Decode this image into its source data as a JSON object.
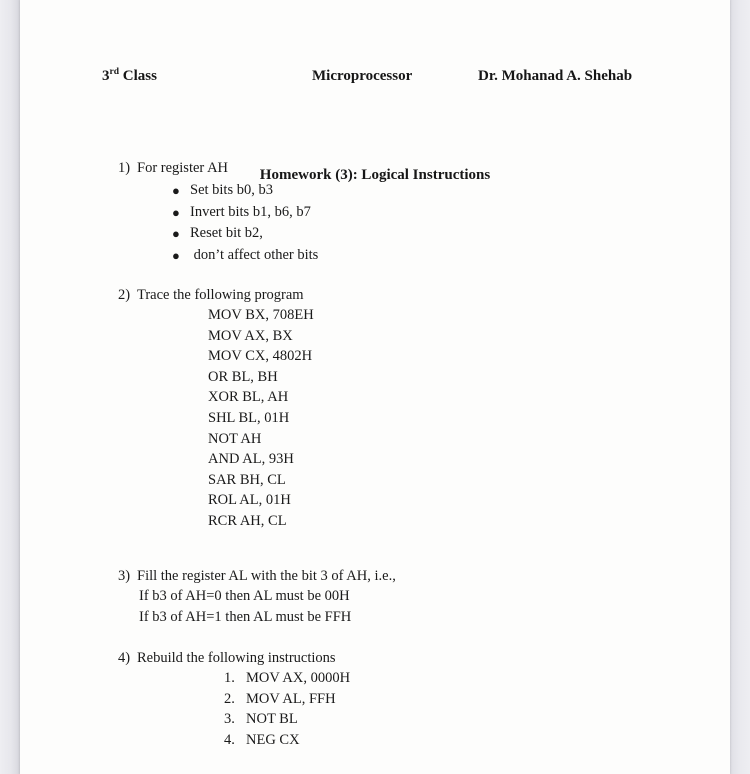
{
  "header": {
    "class_prefix": "3",
    "class_sup": "rd",
    "class_suffix": " Class",
    "subject": "Microprocessor",
    "lecturer": "Dr. Mohanad A. Shehab",
    "subtitle": "Homework (3): Logical Instructions"
  },
  "questions": [
    {
      "number": "1)",
      "title": "For register AH",
      "bullets": [
        "Set bits b0, b3",
        "Invert bits b1, b6, b7",
        "Reset bit b2,",
        " don’t affect other bits"
      ],
      "bullet_glyph": "●"
    },
    {
      "number": "2)",
      "title": "Trace the following program",
      "listing": [
        "MOV BX, 708EH",
        "MOV AX, BX",
        "MOV CX, 4802H",
        "OR BL, BH",
        "XOR BL, AH",
        "SHL BL, 01H",
        "NOT AH",
        "AND AL, 93H",
        "SAR BH, CL",
        "ROL AL, 01H",
        "RCR AH, CL"
      ]
    },
    {
      "number": "3)",
      "title": "Fill the register AL with the bit 3 of AH, i.e.,",
      "sublines": [
        "If b3 of AH=0 then AL must be 00H",
        "If b3 of AH=1 then AL must be FFH"
      ]
    },
    {
      "number": "4)",
      "title": "Rebuild the following instructions",
      "numlist": [
        {
          "index": "1.",
          "text": "MOV AX, 0000H"
        },
        {
          "index": "2.",
          "text": "MOV AL, FFH"
        },
        {
          "index": "3.",
          "text": "NOT BL"
        },
        {
          "index": "4.",
          "text": "NEG CX"
        }
      ]
    }
  ]
}
